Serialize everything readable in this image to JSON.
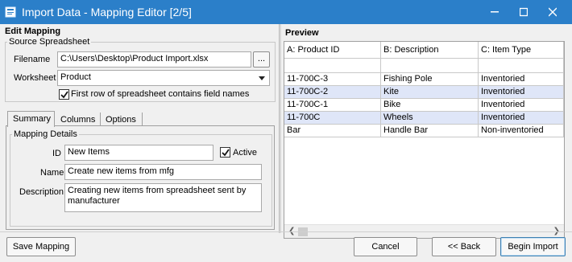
{
  "window": {
    "title": "Import Data - Mapping Editor [2/5]",
    "minimize_icon": "minimize-icon",
    "maximize_icon": "maximize-icon",
    "close_icon": "close-icon"
  },
  "edit_mapping": {
    "heading": "Edit Mapping",
    "source_spreadsheet": {
      "legend": "Source Spreadsheet",
      "filename_label": "Filename",
      "filename_value": "C:\\Users\\Desktop\\Product Import.xlsx",
      "browse_label": "...",
      "worksheet_label": "Worksheet",
      "worksheet_value": "Product",
      "first_row_label": "First row of spreadsheet contains field names",
      "first_row_checked": true
    },
    "tabs": [
      {
        "label": "Summary",
        "active": true
      },
      {
        "label": "Columns",
        "active": false
      },
      {
        "label": "Options",
        "active": false
      }
    ],
    "mapping_details": {
      "legend": "Mapping Details",
      "id_label": "ID",
      "id_value": "New Items",
      "active_label": "Active",
      "active_checked": true,
      "name_label": "Name",
      "name_value": "Create new items from mfg",
      "description_label": "Description",
      "description_value": "Creating new items from spreadsheet sent by manufacturer"
    }
  },
  "preview": {
    "heading": "Preview",
    "columns": [
      "A: Product ID",
      "B: Description",
      "C: Item Type"
    ],
    "rows": [
      {
        "cells": [
          "",
          "",
          ""
        ],
        "selected": false
      },
      {
        "cells": [
          "11-700C-3",
          "Fishing Pole",
          "Inventoried"
        ],
        "selected": false
      },
      {
        "cells": [
          "11-700C-2",
          "Kite",
          "Inventoried"
        ],
        "selected": true
      },
      {
        "cells": [
          "11-700C-1",
          "Bike",
          "Inventoried"
        ],
        "selected": false
      },
      {
        "cells": [
          "11-700C",
          "Wheels",
          "Inventoried"
        ],
        "selected": true
      },
      {
        "cells": [
          "Bar",
          "Handle Bar",
          "Non-inventoried"
        ],
        "selected": false
      }
    ]
  },
  "footer": {
    "save_mapping": "Save Mapping",
    "cancel": "Cancel",
    "back": "<< Back",
    "begin_import": "Begin Import"
  },
  "colors": {
    "titlebar": "#2b7fc9",
    "selected_row": "#dfe6f8"
  }
}
